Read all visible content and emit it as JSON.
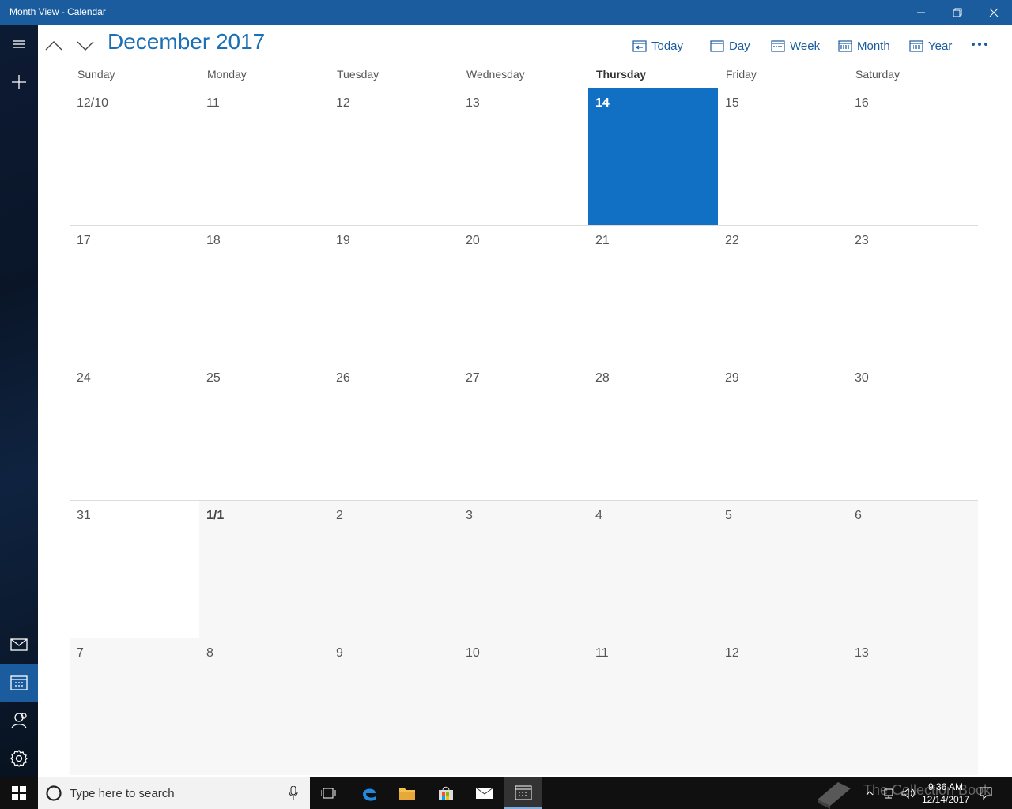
{
  "window": {
    "title": "Month View - Calendar"
  },
  "header": {
    "month_title": "December 2017"
  },
  "commands": {
    "today": "Today",
    "day": "Day",
    "week": "Week",
    "month": "Month",
    "year": "Year"
  },
  "weekdays": [
    "Sunday",
    "Monday",
    "Tuesday",
    "Wednesday",
    "Thursday",
    "Friday",
    "Saturday"
  ],
  "weeks": [
    [
      "12/10",
      "11",
      "12",
      "13",
      "14",
      "15",
      "16"
    ],
    [
      "17",
      "18",
      "19",
      "20",
      "21",
      "22",
      "23"
    ],
    [
      "24",
      "25",
      "26",
      "27",
      "28",
      "29",
      "30"
    ],
    [
      "31",
      "1/1",
      "2",
      "3",
      "4",
      "5",
      "6"
    ],
    [
      "7",
      "8",
      "9",
      "10",
      "11",
      "12",
      "13"
    ]
  ],
  "today_label": "14",
  "taskbar": {
    "search_placeholder": "Type here to search",
    "time": "9:36 AM",
    "date": "12/14/2017",
    "watermark": "The Collection Book"
  },
  "colors": {
    "accent": "#1a5c9e",
    "today_fill": "#1270c4",
    "title_text": "#1a6fb5"
  }
}
